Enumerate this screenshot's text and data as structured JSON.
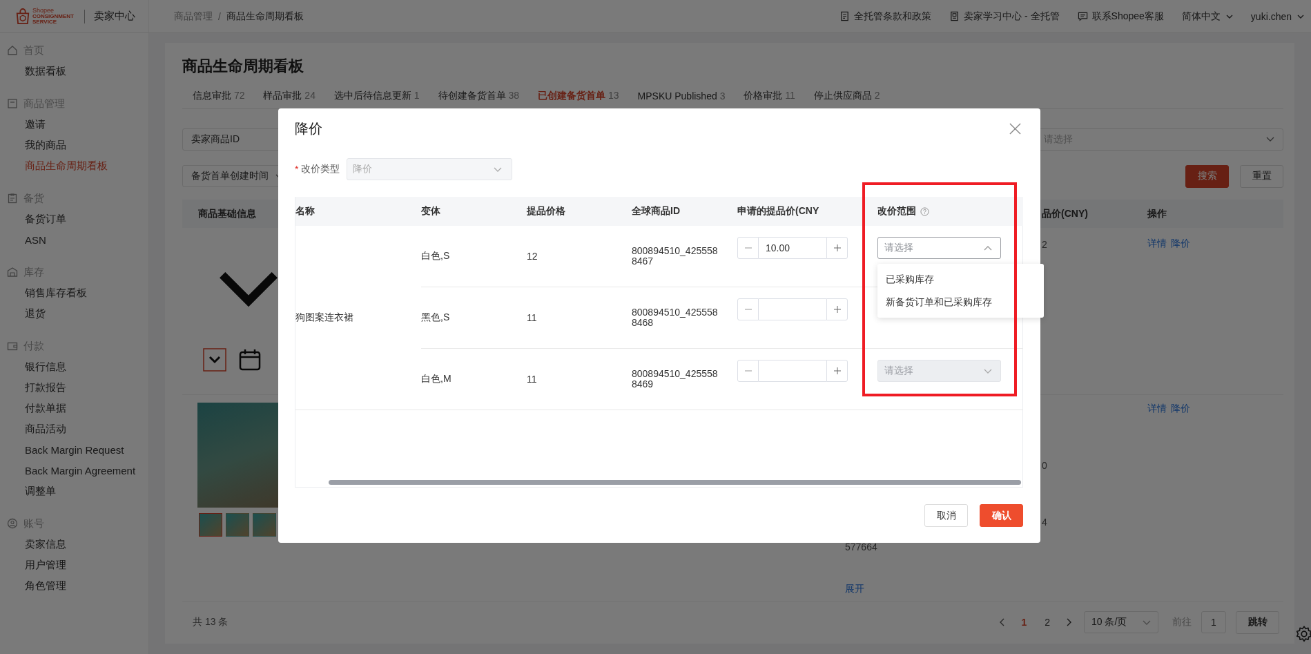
{
  "topbar": {
    "logo": {
      "small": "Shopee",
      "line1": "CONSIGNMENT",
      "line2": "SERVICE"
    },
    "app_name": "卖家中心",
    "breadcrumb": [
      "商品管理",
      "商品生命周期看板"
    ],
    "breadcrumb_separator": "/",
    "links": [
      {
        "label": "全托管条款和政策",
        "kind": "document"
      },
      {
        "label": "卖家学习中心 - 全托管",
        "kind": "book"
      },
      {
        "label": "联系Shopee客服",
        "kind": "chat"
      }
    ],
    "language": "简体中文",
    "user": "yuki.chen"
  },
  "sidebar": {
    "groups": [
      {
        "title": "首页",
        "kind": "home",
        "items": [
          {
            "label": "数据看板",
            "selected": false
          }
        ]
      },
      {
        "title": "商品管理",
        "kind": "box",
        "items": [
          {
            "label": "邀请",
            "selected": false
          },
          {
            "label": "我的商品",
            "selected": false
          },
          {
            "label": "商品生命周期看板",
            "selected": true
          }
        ]
      },
      {
        "title": "备货",
        "kind": "clipboard",
        "items": [
          {
            "label": "备货订单",
            "selected": false
          },
          {
            "label": "ASN",
            "selected": false
          }
        ]
      },
      {
        "title": "库存",
        "kind": "warehouse",
        "items": [
          {
            "label": "销售库存看板",
            "selected": false
          },
          {
            "label": "退货",
            "selected": false
          }
        ]
      },
      {
        "title": "付款",
        "kind": "wallet",
        "items": [
          {
            "label": "银行信息",
            "selected": false
          },
          {
            "label": "打款报告",
            "selected": false
          },
          {
            "label": "付款单据",
            "selected": false
          },
          {
            "label": "商品活动",
            "selected": false
          },
          {
            "label": "Back Margin Request",
            "selected": false
          },
          {
            "label": "Back Margin Agreement",
            "selected": false
          },
          {
            "label": "调整单",
            "selected": false
          }
        ]
      },
      {
        "title": "账号",
        "kind": "user",
        "items": [
          {
            "label": "卖家信息",
            "selected": false
          },
          {
            "label": "用户管理",
            "selected": false
          },
          {
            "label": "角色管理",
            "selected": false
          }
        ]
      }
    ]
  },
  "page": {
    "title": "商品生命周期看板",
    "tabs": [
      {
        "label": "信息审批",
        "count": "72",
        "selected": false
      },
      {
        "label": "样品审批",
        "count": "24",
        "selected": false
      },
      {
        "label": "选中后待信息更新",
        "count": "1",
        "selected": false
      },
      {
        "label": "待创建备货首单",
        "count": "38",
        "selected": false
      },
      {
        "label": "已创建备货首单",
        "count": "13",
        "selected": true
      },
      {
        "label": "MPSKU Published",
        "count": "3",
        "selected": false
      },
      {
        "label": "价格审批",
        "count": "11",
        "selected": false
      },
      {
        "label": "停止供应商品",
        "count": "2",
        "selected": false
      }
    ],
    "filters": {
      "field_1": "卖家商品ID",
      "select_placeholder": "请选择",
      "field_2": "备货首单创建时间"
    },
    "search_button": "搜索",
    "reset_button": "重置",
    "table": {
      "columns": [
        "商品基础信息",
        "品价(CNY)",
        "操作"
      ],
      "products": [
        {
          "kind": "image-missing",
          "price_column": [
            "2"
          ],
          "actions": [
            "详情",
            "降价"
          ]
        },
        {
          "kind": "photo",
          "thumbnails": [
            {
              "selected": true
            },
            {
              "selected": false
            },
            {
              "selected": false
            }
          ],
          "price_column": [
            "0",
            "4"
          ],
          "id_column": [
            "577664"
          ],
          "expand": "展开",
          "actions": [
            "详情",
            "降价"
          ]
        }
      ]
    },
    "footer": {
      "total": "共 13 条",
      "pages": [
        {
          "label": "1",
          "selected": true
        },
        {
          "label": "2",
          "selected": false
        }
      ],
      "page_size": "10 条/页",
      "goto_label": "前往",
      "goto_value": "1",
      "jump": "跳转"
    }
  },
  "dialog": {
    "title": "降价",
    "price_type": {
      "required_mark": "*",
      "label": "改价类型",
      "value": "降价",
      "disabled": true
    },
    "columns": [
      "名称",
      "变体",
      "提品价格",
      "全球商品ID",
      "申请的提品价(CNY",
      "改价范围"
    ],
    "product_name": "狗图案连衣裙",
    "variants": [
      {
        "variant": "白色,S",
        "price": "12",
        "global_id": "800894510_4255588467",
        "requested_price": "10.00",
        "scope": {
          "placeholder": "请选择",
          "open": true,
          "disabled": false
        }
      },
      {
        "variant": "黑色,S",
        "price": "11",
        "global_id": "800894510_4255588468"
      },
      {
        "variant": "白色,M",
        "price": "11",
        "global_id": "800894510_4255588469",
        "scope": {
          "placeholder": "请选择",
          "open": false,
          "disabled": true
        }
      }
    ],
    "scope_options": [
      {
        "label": "已采购库存",
        "selected": false
      },
      {
        "label": "新备货订单和已采购库存",
        "selected": false
      }
    ],
    "cancel_button": "取消",
    "confirm_button": "确认",
    "highlight_frame": true
  }
}
